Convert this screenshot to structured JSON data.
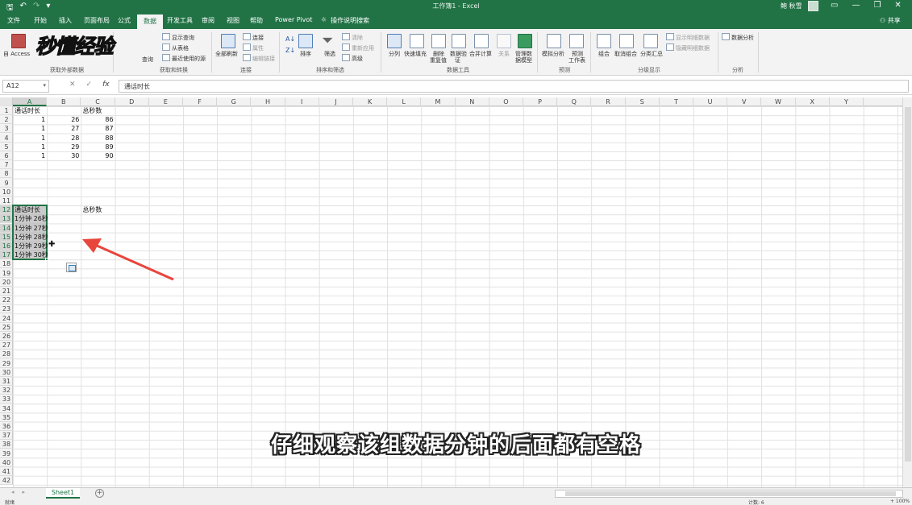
{
  "titlebar": {
    "title": "工作簿1 - Excel",
    "user_name": "鲍 秋雪",
    "qa_save": "🖫",
    "qa_undo": "↶",
    "qa_redo": "↷",
    "qa_more": "▾",
    "win_ribbon": "▭",
    "win_min": "—",
    "win_restore": "❐",
    "win_close": "✕"
  },
  "tabs": {
    "items": [
      "文件",
      "开始",
      "插入",
      "页面布局",
      "公式",
      "数据",
      "开发工具",
      "审阅",
      "视图",
      "帮助",
      "Power Pivot"
    ],
    "active": "数据",
    "tell_me": "操作说明搜索",
    "share": "共享"
  },
  "ribbon": {
    "watermark": "秒懂经验",
    "get_external": {
      "access": "自 Access",
      "label": "获取外部数据"
    },
    "get_transform": {
      "label": "获取和转换",
      "show_query": "显示查询",
      "from_table": "从表格",
      "recent_sources": "最近使用的源",
      "new_query": "查询"
    },
    "connections": {
      "label": "连接",
      "refresh_all": "全部刷新",
      "connections": "连接",
      "properties": "属性",
      "edit_links": "编辑链接"
    },
    "sort_filter": {
      "label": "排序和筛选",
      "sort": "排序",
      "filter": "筛选",
      "clear": "清除",
      "reapply": "重新应用",
      "advanced": "高级"
    },
    "data_tools": {
      "label": "数据工具",
      "text_to_columns": "分列",
      "flash_fill": "快速填充",
      "remove_dup_1": "删除",
      "remove_dup_2": "重复值",
      "validation_1": "数据验",
      "validation_2": "证",
      "consolidate": "合并计算",
      "relationships": "关系",
      "manage_model_1": "管理数",
      "manage_model_2": "据模型"
    },
    "forecast": {
      "label": "预测",
      "what_if": "模拟分析",
      "forecast_sheet_1": "预测",
      "forecast_sheet_2": "工作表"
    },
    "outline": {
      "label": "分级显示",
      "group": "组合",
      "ungroup": "取消组合",
      "subtotal": "分类汇总",
      "show_detail": "显示明细数据",
      "hide_detail": "隐藏明细数据"
    },
    "analysis": {
      "label": "分析",
      "data_analysis": "数据分析"
    }
  },
  "formula_bar": {
    "name_box": "A12",
    "cancel": "✕",
    "enter": "✓",
    "fx": "fx",
    "content": "通话时长"
  },
  "grid": {
    "columns": [
      "A",
      "B",
      "C",
      "D",
      "E",
      "F",
      "G",
      "H",
      "I",
      "J",
      "K",
      "L",
      "M",
      "N",
      "O",
      "P",
      "Q",
      "R",
      "S",
      "T",
      "U",
      "V",
      "W",
      "X",
      "Y"
    ],
    "rows": [
      "1",
      "2",
      "3",
      "4",
      "5",
      "6",
      "7",
      "8",
      "9",
      "10",
      "11",
      "12",
      "13",
      "14",
      "15",
      "16",
      "17",
      "18",
      "19",
      "20",
      "21",
      "22",
      "23",
      "24",
      "25",
      "26",
      "27",
      "28",
      "29",
      "30",
      "31",
      "32",
      "33",
      "34",
      "35",
      "36",
      "37",
      "38",
      "39",
      "40",
      "41",
      "42"
    ],
    "cells": {
      "A1": "通话时长",
      "C1": "总秒数",
      "A2": "1",
      "B2": "26",
      "C2": "86",
      "A3": "1",
      "B3": "27",
      "C3": "87",
      "A4": "1",
      "B4": "28",
      "C4": "88",
      "A5": "1",
      "B5": "29",
      "C5": "89",
      "A6": "1",
      "B6": "30",
      "C6": "90",
      "A12": "通话时长",
      "C12": "总秒数",
      "A13": "1分钟 26秒",
      "A14": "1分钟 27秒",
      "A15": "1分钟 28秒",
      "A16": "1分钟 29秒",
      "A17": "1分钟 30秒"
    }
  },
  "caption": "仔细观察该组数据分钟的后面都有空格",
  "sheets": {
    "tabs": [
      "Sheet1"
    ],
    "add": "+",
    "nav_prev": "◂",
    "nav_next": "▸"
  },
  "statusbar": {
    "left": "就绪",
    "count": "计数: 6",
    "zoom": "+ 100%"
  },
  "colors": {
    "accent": "#217346",
    "arrow": "#e8453c"
  }
}
